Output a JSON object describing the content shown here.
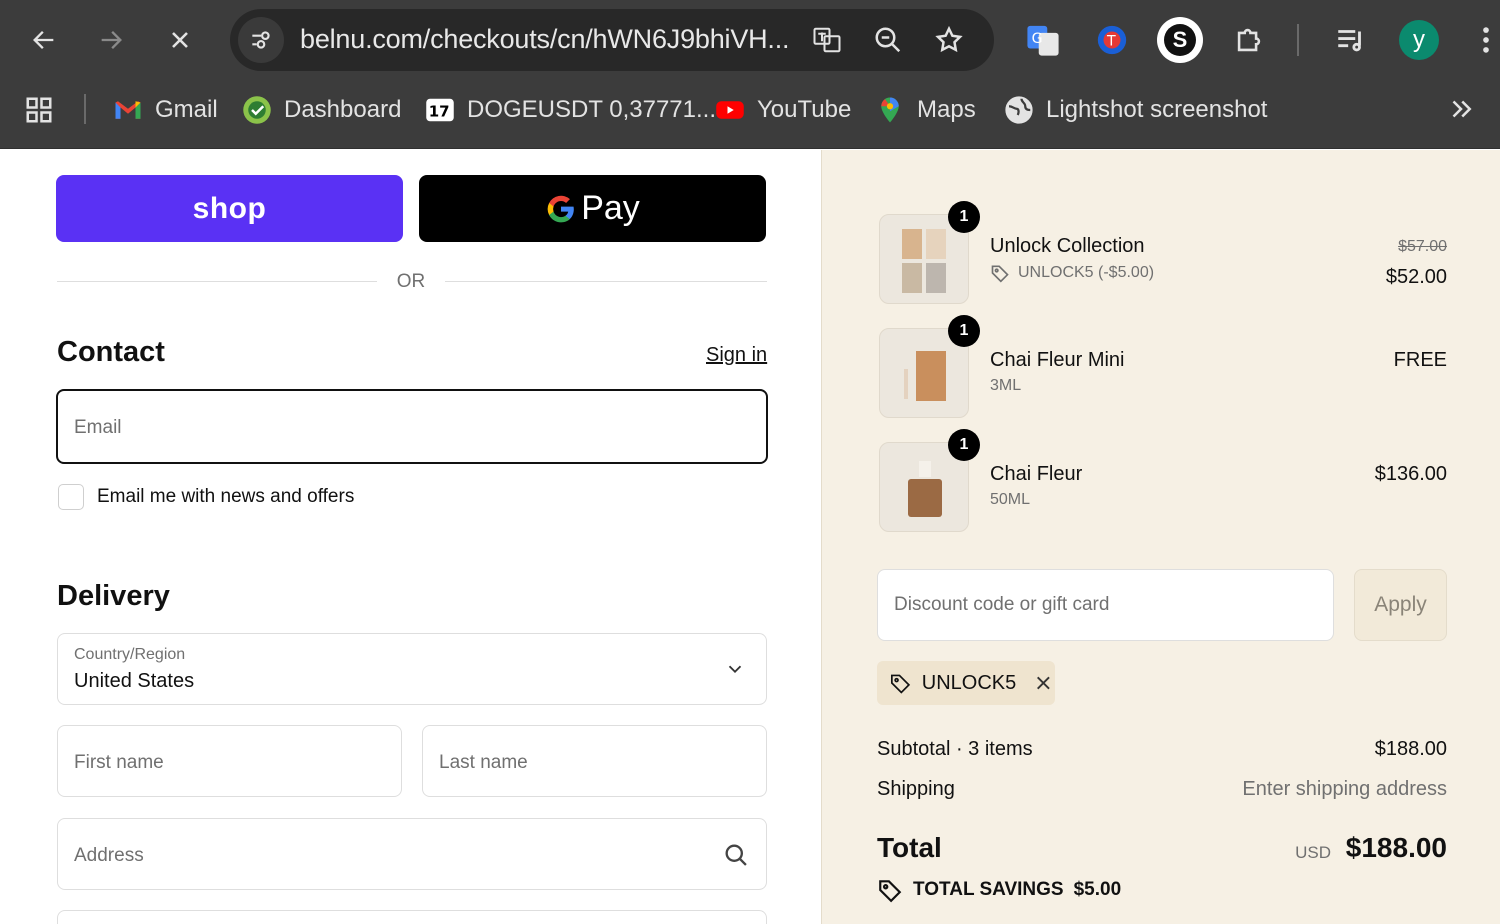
{
  "browser": {
    "url": "belnu.com/checkouts/cn/hWN6J9bhiVH...",
    "bookmarks": [
      {
        "label": "Gmail",
        "icon": "gmail-icon"
      },
      {
        "label": "Dashboard",
        "icon": "dashboard-icon"
      },
      {
        "label": "DOGEUSDT 0,37771...",
        "icon": "tradingview-icon"
      },
      {
        "label": "YouTube",
        "icon": "youtube-icon"
      },
      {
        "label": "Maps",
        "icon": "maps-icon"
      },
      {
        "label": "Lightshot screenshot",
        "icon": "globe-icon"
      }
    ],
    "profile_initial": "y",
    "extension_s": "S"
  },
  "checkout": {
    "shop_pay_label": "shop",
    "gpay_label": "Pay",
    "or_label": "OR",
    "contact": {
      "heading": "Contact",
      "sign_in": "Sign in",
      "email_placeholder": "Email",
      "newsletter_label": "Email me with news and offers"
    },
    "delivery": {
      "heading": "Delivery",
      "country_label": "Country/Region",
      "country_value": "United States",
      "first_name_placeholder": "First name",
      "last_name_placeholder": "Last name",
      "address_placeholder": "Address"
    }
  },
  "summary": {
    "items": [
      {
        "qty": "1",
        "name": "Unlock Collection",
        "sub": "UNLOCK5 (-$5.00)",
        "old_price": "$57.00",
        "price": "$52.00"
      },
      {
        "qty": "1",
        "name": "Chai Fleur Mini",
        "sub": "3ML",
        "price": "FREE"
      },
      {
        "qty": "1",
        "name": "Chai Fleur",
        "sub": "50ML",
        "price": "$136.00"
      }
    ],
    "discount_placeholder": "Discount code or gift card",
    "apply_label": "Apply",
    "applied_code": "UNLOCK5",
    "subtotal_label": "Subtotal · 3 items",
    "subtotal_value": "$188.00",
    "shipping_label": "Shipping",
    "shipping_value": "Enter shipping address",
    "total_label": "Total",
    "total_currency": "USD",
    "total_value": "$188.00",
    "savings_label": "TOTAL SAVINGS",
    "savings_value": "$5.00"
  },
  "colors": {
    "shop_pay": "#5a31f4",
    "summary_bg": "#f6f0e4",
    "chrome_bg": "#3c3c3c"
  }
}
